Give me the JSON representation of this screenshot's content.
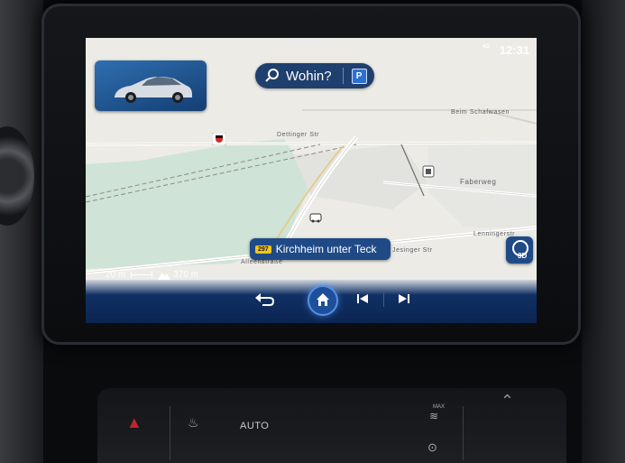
{
  "status_bar": {
    "network": "4G",
    "time": "12:31"
  },
  "search": {
    "label": "Wohin?",
    "parking_label": "P"
  },
  "map": {
    "streets": [
      "Beim Schafwasen",
      "Dettinger Str",
      "Faberweg",
      "Lenningerstr",
      "Alleenstraße",
      "Jesinger Str"
    ],
    "destination": {
      "badge": "297",
      "name": "Kirchheim unter Teck",
      "tail": "Jesinger Str"
    },
    "view_mode": "3D",
    "scale": "20 m",
    "elevation": "370 m"
  },
  "console": {
    "climate_mode": "AUTO",
    "max_label": "MAX"
  },
  "colors": {
    "bar": "#0c2552",
    "accent": "#2d6fd2",
    "badge": "#f3c31a",
    "park": "#cfe3d6"
  },
  "icons": [
    "search-icon",
    "parking-icon",
    "back-arrow-icon",
    "home-icon",
    "skip-back-icon",
    "skip-forward-icon",
    "compass-icon"
  ]
}
